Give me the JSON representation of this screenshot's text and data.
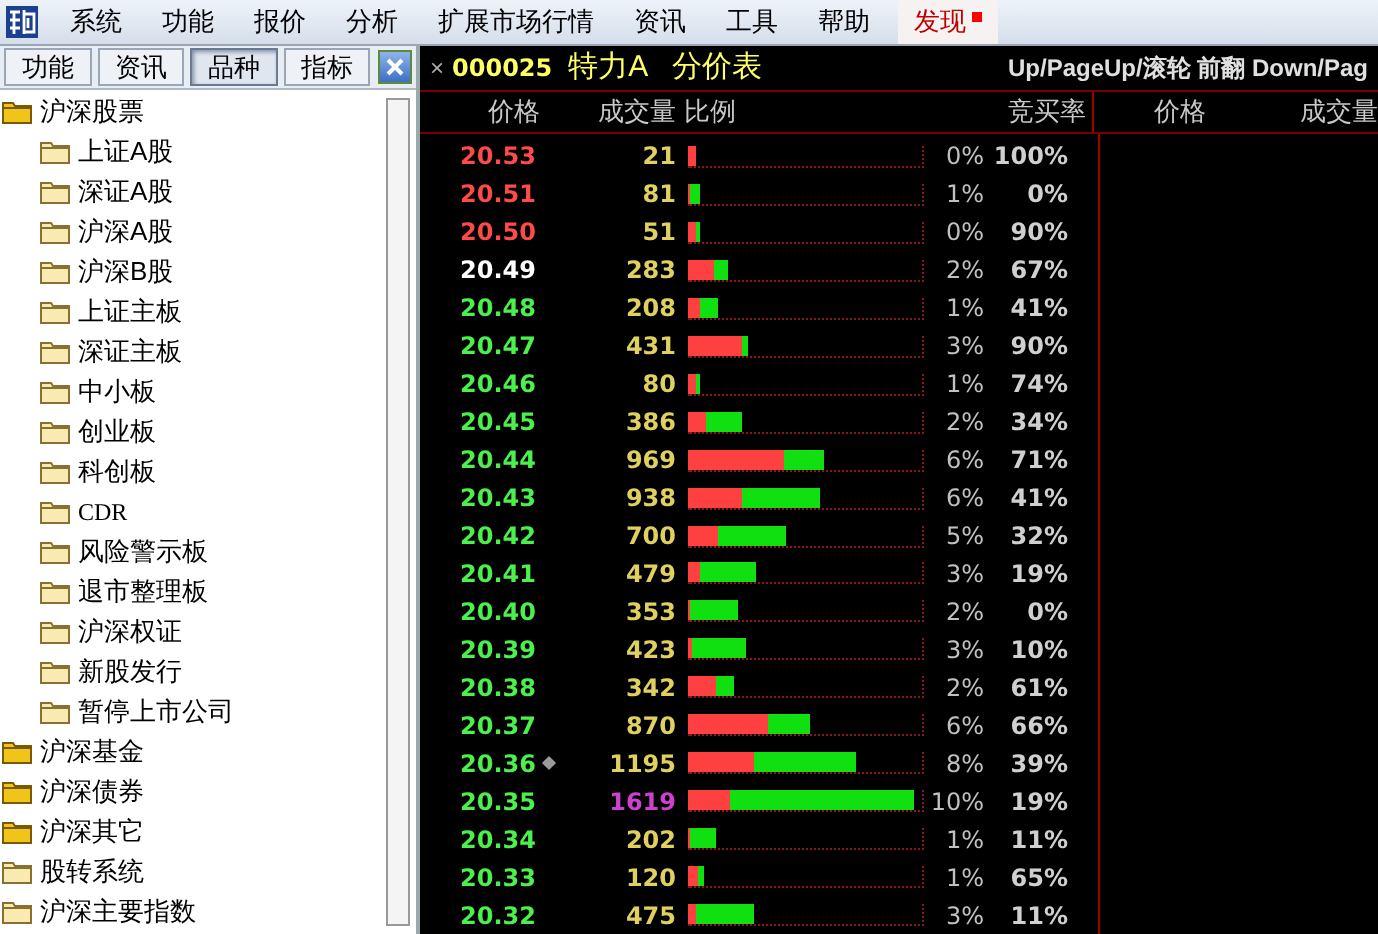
{
  "menu": [
    {
      "label": "系统",
      "highlighted": false
    },
    {
      "label": "功能",
      "highlighted": false
    },
    {
      "label": "报价",
      "highlighted": false
    },
    {
      "label": "分析",
      "highlighted": false
    },
    {
      "label": "扩展市场行情",
      "highlighted": false
    },
    {
      "label": "资讯",
      "highlighted": false
    },
    {
      "label": "工具",
      "highlighted": false
    },
    {
      "label": "帮助",
      "highlighted": false
    },
    {
      "label": "发现",
      "highlighted": true
    }
  ],
  "sidebar": {
    "tabs": [
      {
        "label": "功能",
        "selected": false
      },
      {
        "label": "资讯",
        "selected": false
      },
      {
        "label": "品种",
        "selected": true
      },
      {
        "label": "指标",
        "selected": false
      }
    ],
    "tree": [
      {
        "label": "沪深股票",
        "expanded": true,
        "children": [
          {
            "label": "上证A股"
          },
          {
            "label": "深证A股"
          },
          {
            "label": "沪深A股"
          },
          {
            "label": "沪深B股"
          },
          {
            "label": "上证主板"
          },
          {
            "label": "深证主板"
          },
          {
            "label": "中小板"
          },
          {
            "label": "创业板"
          },
          {
            "label": "科创板"
          },
          {
            "label": "CDR"
          },
          {
            "label": "风险警示板"
          },
          {
            "label": "退市整理板"
          },
          {
            "label": "沪深权证"
          },
          {
            "label": "新股发行"
          },
          {
            "label": "暂停上市公司"
          }
        ]
      },
      {
        "label": "沪深基金",
        "expanded": true
      },
      {
        "label": "沪深债券",
        "expanded": true
      },
      {
        "label": "沪深其它",
        "expanded": true
      },
      {
        "label": "股转系统",
        "expanded": false
      },
      {
        "label": "沪深主要指数",
        "expanded": false
      }
    ]
  },
  "panel": {
    "close": "×",
    "code": "000025",
    "name": "特力A",
    "title": "分价表",
    "hint": "Up/PageUp/滚轮 前翻 Down/Pag",
    "columns": [
      "价格",
      "成交量",
      "比例",
      "竞买率"
    ],
    "columns_right": [
      "价格",
      "成交量"
    ],
    "rows": [
      {
        "price": "20.53",
        "color": "#ff4a4a",
        "volume": "21",
        "max": false,
        "marker": false,
        "bar": {
          "level": 0.03
        },
        "buy": {
          "level": 0.03
        },
        "share": "0%",
        "rate": "100%"
      },
      {
        "price": "20.51",
        "color": "#ff4a4a",
        "volume": "81",
        "max": false,
        "marker": false,
        "bar": {
          "level": 0.05
        },
        "buy": {
          "level": 0
        },
        "share": "1%",
        "rate": "0%"
      },
      {
        "price": "20.50",
        "color": "#ff4a4a",
        "volume": "51",
        "max": false,
        "marker": false,
        "bar": {
          "level": 0.05
        },
        "buy": {
          "level": 0.035
        },
        "share": "0%",
        "rate": "90%"
      },
      {
        "price": "20.49",
        "color": "#ffffff",
        "volume": "283",
        "max": false,
        "marker": false,
        "bar": {
          "level": 0.17
        },
        "buy": {
          "level": 0.11
        },
        "share": "2%",
        "rate": "67%"
      },
      {
        "price": "20.48",
        "color": "#4cf04c",
        "volume": "208",
        "max": false,
        "marker": false,
        "bar": {
          "level": 0.125
        },
        "buy": {
          "level": 0.05
        },
        "share": "1%",
        "rate": "41%"
      },
      {
        "price": "20.47",
        "color": "#4cf04c",
        "volume": "431",
        "max": false,
        "marker": false,
        "bar": {
          "level": 0.26
        },
        "buy": {
          "level": 0.23
        },
        "share": "3%",
        "rate": "90%"
      },
      {
        "price": "20.46",
        "color": "#4cf04c",
        "volume": "80",
        "max": false,
        "marker": false,
        "bar": {
          "level": 0.05
        },
        "buy": {
          "level": 0.035
        },
        "share": "1%",
        "rate": "74%"
      },
      {
        "price": "20.45",
        "color": "#4cf04c",
        "volume": "386",
        "max": false,
        "marker": false,
        "bar": {
          "level": 0.23
        },
        "buy": {
          "level": 0.08
        },
        "share": "2%",
        "rate": "34%"
      },
      {
        "price": "20.44",
        "color": "#4cf04c",
        "volume": "969",
        "max": false,
        "marker": false,
        "bar": {
          "level": 0.58
        },
        "buy": {
          "level": 0.41
        },
        "share": "6%",
        "rate": "71%"
      },
      {
        "price": "20.43",
        "color": "#4cf04c",
        "volume": "938",
        "max": false,
        "marker": false,
        "bar": {
          "level": 0.56
        },
        "buy": {
          "level": 0.23
        },
        "share": "6%",
        "rate": "41%"
      },
      {
        "price": "20.42",
        "color": "#4cf04c",
        "volume": "700",
        "max": false,
        "marker": false,
        "bar": {
          "level": 0.42
        },
        "buy": {
          "level": 0.13
        },
        "share": "5%",
        "rate": "32%"
      },
      {
        "price": "20.41",
        "color": "#4cf04c",
        "volume": "479",
        "max": false,
        "marker": false,
        "bar": {
          "level": 0.29
        },
        "buy": {
          "level": 0.05
        },
        "share": "3%",
        "rate": "19%"
      },
      {
        "price": "20.40",
        "color": "#4cf04c",
        "volume": "353",
        "max": false,
        "marker": false,
        "bar": {
          "level": 0.21
        },
        "buy": {
          "level": 0
        },
        "share": "2%",
        "rate": "0%"
      },
      {
        "price": "20.39",
        "color": "#4cf04c",
        "volume": "423",
        "max": false,
        "marker": false,
        "bar": {
          "level": 0.25
        },
        "buy": {
          "level": 0.02
        },
        "share": "3%",
        "rate": "10%"
      },
      {
        "price": "20.38",
        "color": "#4cf04c",
        "volume": "342",
        "max": false,
        "marker": false,
        "bar": {
          "level": 0.2
        },
        "buy": {
          "level": 0.12
        },
        "share": "2%",
        "rate": "61%"
      },
      {
        "price": "20.37",
        "color": "#4cf04c",
        "volume": "870",
        "max": false,
        "marker": false,
        "bar": {
          "level": 0.52
        },
        "buy": {
          "level": 0.34
        },
        "share": "6%",
        "rate": "66%"
      },
      {
        "price": "20.36",
        "color": "#4cf04c",
        "volume": "1195",
        "max": false,
        "marker": true,
        "bar": {
          "level": 0.72
        },
        "buy": {
          "level": 0.28
        },
        "share": "8%",
        "rate": "39%"
      },
      {
        "price": "20.35",
        "color": "#4cf04c",
        "volume": "1619",
        "max": true,
        "marker": false,
        "bar": {
          "level": 0.97
        },
        "buy": {
          "level": 0.18
        },
        "share": "10%",
        "rate": "19%"
      },
      {
        "price": "20.34",
        "color": "#4cf04c",
        "volume": "202",
        "max": false,
        "marker": false,
        "bar": {
          "level": 0.12
        },
        "buy": {
          "level": 0.01
        },
        "share": "1%",
        "rate": "11%"
      },
      {
        "price": "20.33",
        "color": "#4cf04c",
        "volume": "120",
        "max": false,
        "marker": false,
        "bar": {
          "level": 0.07
        },
        "buy": {
          "level": 0.045
        },
        "share": "1%",
        "rate": "65%"
      },
      {
        "price": "20.32",
        "color": "#4cf04c",
        "volume": "475",
        "max": false,
        "marker": false,
        "bar": {
          "level": 0.28
        },
        "buy": {
          "level": 0.03
        },
        "share": "3%",
        "rate": "11%"
      }
    ]
  }
}
